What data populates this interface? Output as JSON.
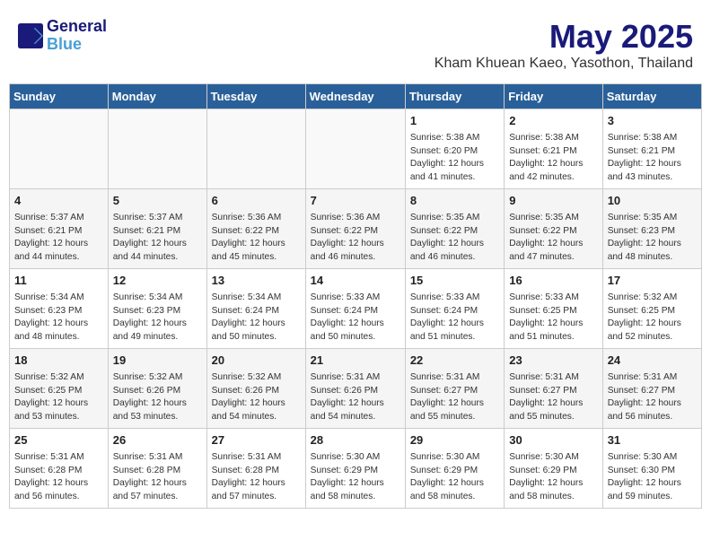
{
  "logo": {
    "line1": "General",
    "line2": "Blue"
  },
  "title": "May 2025",
  "subtitle": "Kham Khuean Kaeo, Yasothon, Thailand",
  "days_of_week": [
    "Sunday",
    "Monday",
    "Tuesday",
    "Wednesday",
    "Thursday",
    "Friday",
    "Saturday"
  ],
  "weeks": [
    [
      {
        "day": "",
        "content": ""
      },
      {
        "day": "",
        "content": ""
      },
      {
        "day": "",
        "content": ""
      },
      {
        "day": "",
        "content": ""
      },
      {
        "day": "1",
        "content": "Sunrise: 5:38 AM\nSunset: 6:20 PM\nDaylight: 12 hours\nand 41 minutes."
      },
      {
        "day": "2",
        "content": "Sunrise: 5:38 AM\nSunset: 6:21 PM\nDaylight: 12 hours\nand 42 minutes."
      },
      {
        "day": "3",
        "content": "Sunrise: 5:38 AM\nSunset: 6:21 PM\nDaylight: 12 hours\nand 43 minutes."
      }
    ],
    [
      {
        "day": "4",
        "content": "Sunrise: 5:37 AM\nSunset: 6:21 PM\nDaylight: 12 hours\nand 44 minutes."
      },
      {
        "day": "5",
        "content": "Sunrise: 5:37 AM\nSunset: 6:21 PM\nDaylight: 12 hours\nand 44 minutes."
      },
      {
        "day": "6",
        "content": "Sunrise: 5:36 AM\nSunset: 6:22 PM\nDaylight: 12 hours\nand 45 minutes."
      },
      {
        "day": "7",
        "content": "Sunrise: 5:36 AM\nSunset: 6:22 PM\nDaylight: 12 hours\nand 46 minutes."
      },
      {
        "day": "8",
        "content": "Sunrise: 5:35 AM\nSunset: 6:22 PM\nDaylight: 12 hours\nand 46 minutes."
      },
      {
        "day": "9",
        "content": "Sunrise: 5:35 AM\nSunset: 6:22 PM\nDaylight: 12 hours\nand 47 minutes."
      },
      {
        "day": "10",
        "content": "Sunrise: 5:35 AM\nSunset: 6:23 PM\nDaylight: 12 hours\nand 48 minutes."
      }
    ],
    [
      {
        "day": "11",
        "content": "Sunrise: 5:34 AM\nSunset: 6:23 PM\nDaylight: 12 hours\nand 48 minutes."
      },
      {
        "day": "12",
        "content": "Sunrise: 5:34 AM\nSunset: 6:23 PM\nDaylight: 12 hours\nand 49 minutes."
      },
      {
        "day": "13",
        "content": "Sunrise: 5:34 AM\nSunset: 6:24 PM\nDaylight: 12 hours\nand 50 minutes."
      },
      {
        "day": "14",
        "content": "Sunrise: 5:33 AM\nSunset: 6:24 PM\nDaylight: 12 hours\nand 50 minutes."
      },
      {
        "day": "15",
        "content": "Sunrise: 5:33 AM\nSunset: 6:24 PM\nDaylight: 12 hours\nand 51 minutes."
      },
      {
        "day": "16",
        "content": "Sunrise: 5:33 AM\nSunset: 6:25 PM\nDaylight: 12 hours\nand 51 minutes."
      },
      {
        "day": "17",
        "content": "Sunrise: 5:32 AM\nSunset: 6:25 PM\nDaylight: 12 hours\nand 52 minutes."
      }
    ],
    [
      {
        "day": "18",
        "content": "Sunrise: 5:32 AM\nSunset: 6:25 PM\nDaylight: 12 hours\nand 53 minutes."
      },
      {
        "day": "19",
        "content": "Sunrise: 5:32 AM\nSunset: 6:26 PM\nDaylight: 12 hours\nand 53 minutes."
      },
      {
        "day": "20",
        "content": "Sunrise: 5:32 AM\nSunset: 6:26 PM\nDaylight: 12 hours\nand 54 minutes."
      },
      {
        "day": "21",
        "content": "Sunrise: 5:31 AM\nSunset: 6:26 PM\nDaylight: 12 hours\nand 54 minutes."
      },
      {
        "day": "22",
        "content": "Sunrise: 5:31 AM\nSunset: 6:27 PM\nDaylight: 12 hours\nand 55 minutes."
      },
      {
        "day": "23",
        "content": "Sunrise: 5:31 AM\nSunset: 6:27 PM\nDaylight: 12 hours\nand 55 minutes."
      },
      {
        "day": "24",
        "content": "Sunrise: 5:31 AM\nSunset: 6:27 PM\nDaylight: 12 hours\nand 56 minutes."
      }
    ],
    [
      {
        "day": "25",
        "content": "Sunrise: 5:31 AM\nSunset: 6:28 PM\nDaylight: 12 hours\nand 56 minutes."
      },
      {
        "day": "26",
        "content": "Sunrise: 5:31 AM\nSunset: 6:28 PM\nDaylight: 12 hours\nand 57 minutes."
      },
      {
        "day": "27",
        "content": "Sunrise: 5:31 AM\nSunset: 6:28 PM\nDaylight: 12 hours\nand 57 minutes."
      },
      {
        "day": "28",
        "content": "Sunrise: 5:30 AM\nSunset: 6:29 PM\nDaylight: 12 hours\nand 58 minutes."
      },
      {
        "day": "29",
        "content": "Sunrise: 5:30 AM\nSunset: 6:29 PM\nDaylight: 12 hours\nand 58 minutes."
      },
      {
        "day": "30",
        "content": "Sunrise: 5:30 AM\nSunset: 6:29 PM\nDaylight: 12 hours\nand 58 minutes."
      },
      {
        "day": "31",
        "content": "Sunrise: 5:30 AM\nSunset: 6:30 PM\nDaylight: 12 hours\nand 59 minutes."
      }
    ]
  ]
}
